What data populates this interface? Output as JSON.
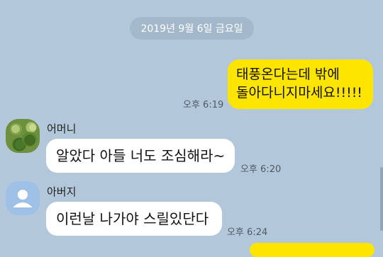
{
  "date_divider": "2019년 9월 6일 금요일",
  "messages": [
    {
      "sender": "me",
      "lines": [
        "태풍온다는데 밖에",
        "돌아다니지마세요!!!!!"
      ],
      "time": "오후 6:19"
    },
    {
      "sender": "어머니",
      "text": "알았다 아들 너도 조심해라~",
      "time": "오후 6:20",
      "avatar": "profile-photo"
    },
    {
      "sender": "아버지",
      "text": "이런날 나가야 스릴있단다",
      "time": "오후 6:24",
      "avatar": "default-profile-icon"
    }
  ],
  "colors": {
    "background": "#b2c7d9",
    "my_bubble": "#fee500",
    "their_bubble": "#ffffff"
  }
}
